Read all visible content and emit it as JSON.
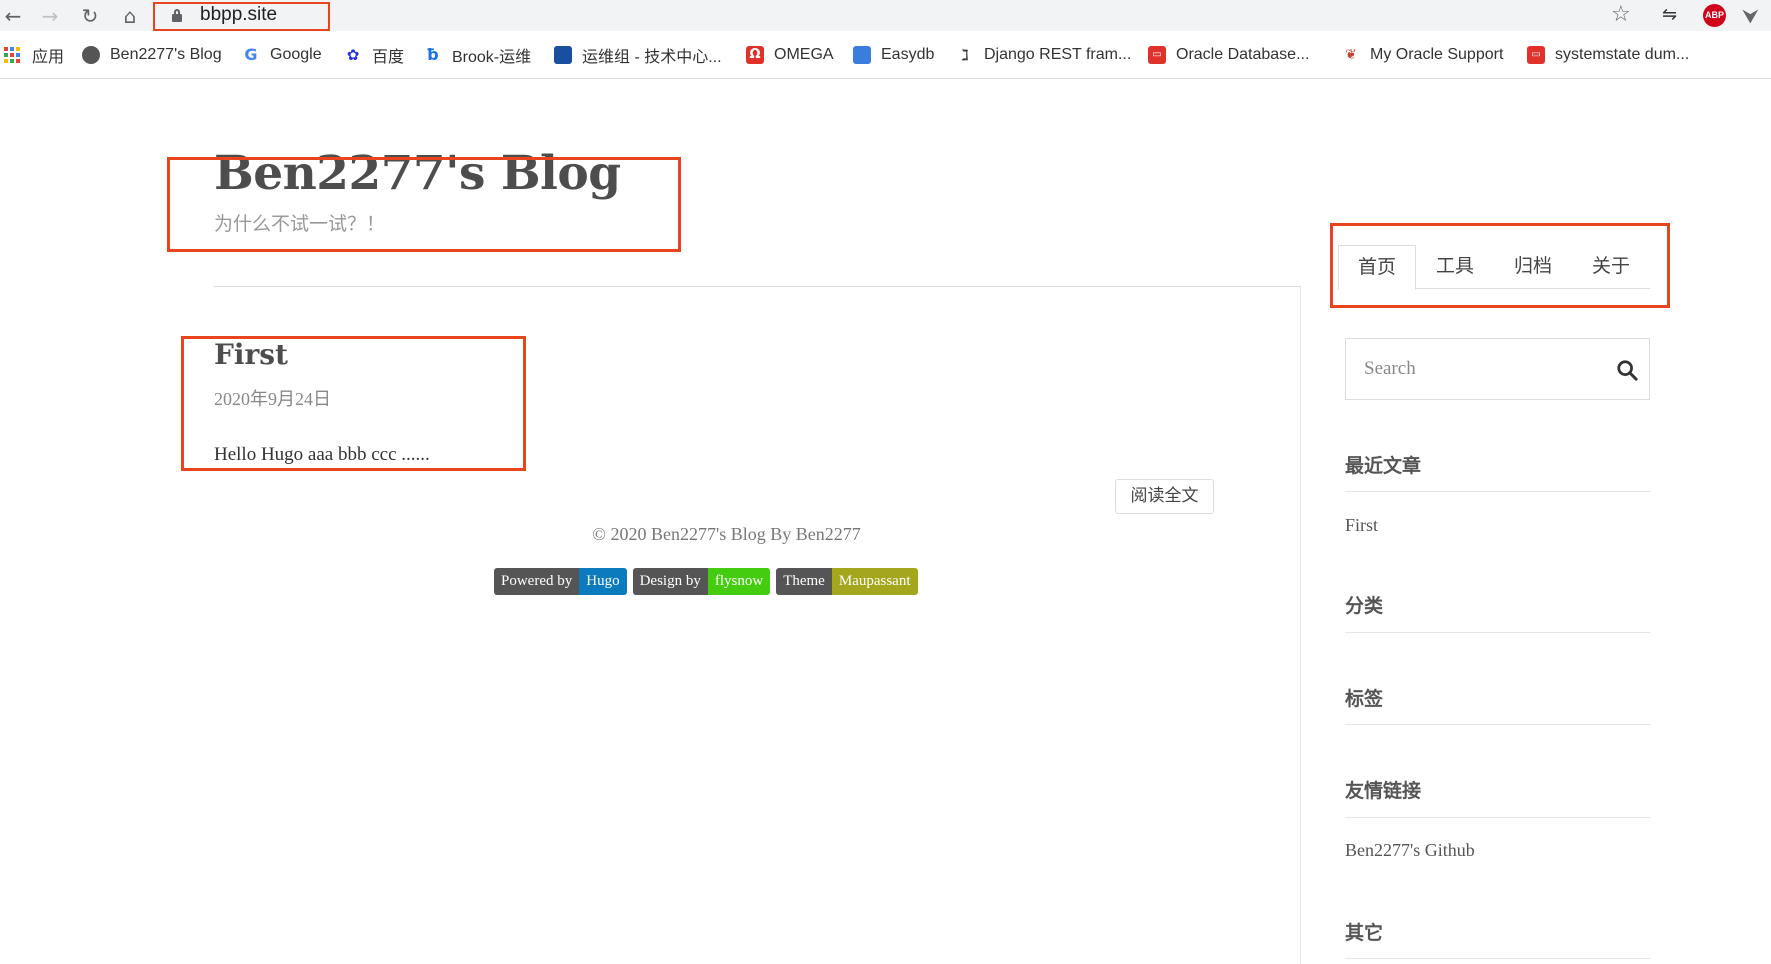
{
  "browser": {
    "url": "bbpp.site",
    "nav_back": "←",
    "nav_forward": "→",
    "nav_reload": "↻",
    "nav_home": "⌂",
    "star": "☆",
    "abp_label": "ABP",
    "sync_glyph": "⇋",
    "menu_glyph": "⮟"
  },
  "bookmarks": [
    {
      "label": "应用",
      "icon": "apps-icon"
    },
    {
      "label": "Ben2277's Blog",
      "icon": "globe-icon"
    },
    {
      "label": "Google",
      "icon": "google-icon"
    },
    {
      "label": "百度",
      "icon": "baidu-icon"
    },
    {
      "label": "Brook-运维",
      "icon": "brook-icon"
    },
    {
      "label": "运维组 - 技术中心...",
      "icon": "ops-icon"
    },
    {
      "label": "OMEGA",
      "icon": "omega-icon"
    },
    {
      "label": "Easydb",
      "icon": "easydb-icon"
    },
    {
      "label": "Django REST fram...",
      "icon": "django-icon"
    },
    {
      "label": "Oracle Database...",
      "icon": "oracle-icon"
    },
    {
      "label": "My Oracle Support",
      "icon": "mos-icon"
    },
    {
      "label": "systemstate dum...",
      "icon": "oracle-icon"
    }
  ],
  "site": {
    "title": "Ben2277's Blog",
    "subtitle": "为什么不试一试？！"
  },
  "nav": {
    "items": [
      "首页",
      "工具",
      "归档",
      "关于"
    ],
    "active_index": 0
  },
  "post": {
    "title": "First",
    "date": "2020年9月24日",
    "excerpt": "Hello Hugo aaa bbb ccc ......",
    "read_more": "阅读全文"
  },
  "footer": {
    "copyright": "© 2020 Ben2277's Blog By Ben2277",
    "badges": [
      {
        "key": "Powered by",
        "value": "Hugo",
        "color": "#0b7bbd"
      },
      {
        "key": "Design by",
        "value": "flysnow",
        "color": "#44cc11"
      },
      {
        "key": "Theme",
        "value": "Maupassant",
        "color": "#a4a61d"
      }
    ]
  },
  "sidebar": {
    "search_placeholder": "Search",
    "recent_heading": "最近文章",
    "recent_items": [
      "First"
    ],
    "categories_heading": "分类",
    "tags_heading": "标签",
    "links_heading": "友情链接",
    "links": [
      "Ben2277's Github"
    ],
    "other_heading": "其它"
  },
  "colors": {
    "highlight_box": "#e8451e",
    "title_text": "#4d4d4d"
  }
}
